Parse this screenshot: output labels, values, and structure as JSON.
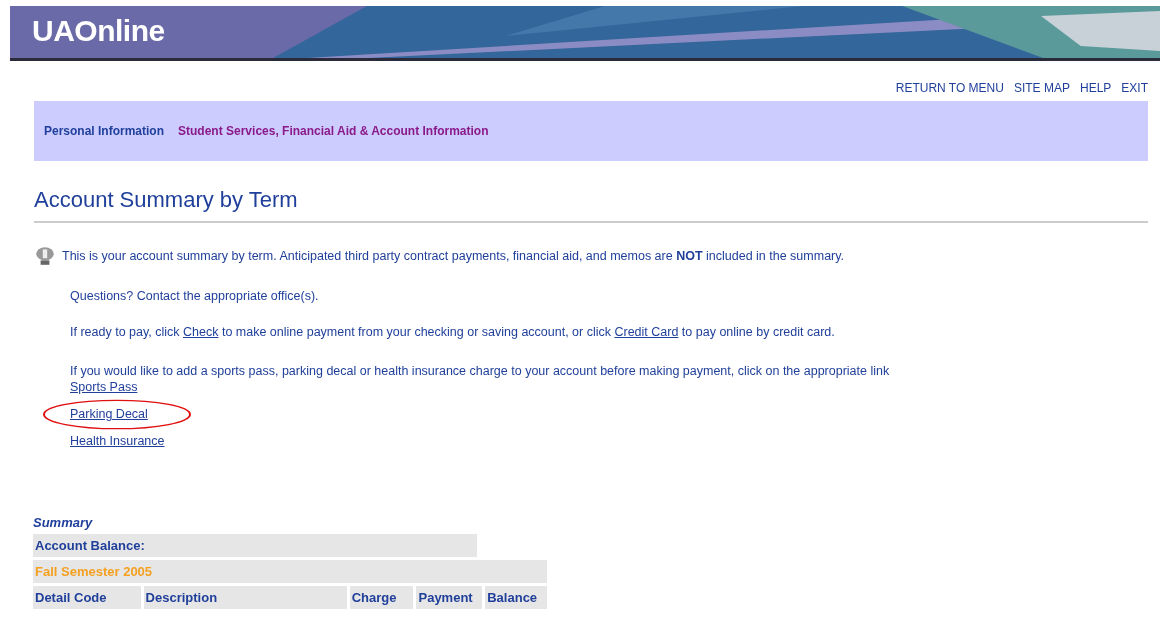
{
  "header": {
    "logo": "UAOnline"
  },
  "top_links": [
    "RETURN TO MENU",
    "SITE MAP",
    "HELP",
    "EXIT"
  ],
  "nav_tabs": [
    {
      "label": "Personal Information",
      "selected": false
    },
    {
      "label": "Student Services, Financial Aid & Account Information",
      "selected": true
    }
  ],
  "page_title": "Account Summary by Term",
  "info_text": "This is your account summary by term. Anticipated third party contract payments, financial aid, and memos are **NOT** included in the summary.",
  "questions_text": "Questions? Contact the appropriate office(s).",
  "pay_text": {
    "before": "If ready to pay, click",
    "check_link": "Check",
    "middle": "to make online payment from your checking or saving account, or click",
    "card_link": "Credit Card",
    "after": "to pay online by credit card."
  },
  "addon_text": "If you would like to add a sports pass, parking decal or health insurance charge to your account before making payment, click on the appropriate link",
  "addon_links": [
    {
      "label": "Sports Pass",
      "circled": false
    },
    {
      "label": "Parking Decal",
      "circled": true
    },
    {
      "label": "Health Insurance",
      "circled": false
    }
  ],
  "summary": {
    "title": "Summary",
    "balance_label": "Account Balance:",
    "term": "Fall Semester 2005",
    "columns": [
      "Detail Code",
      "Description",
      "Charge",
      "Payment",
      "Balance"
    ]
  }
}
